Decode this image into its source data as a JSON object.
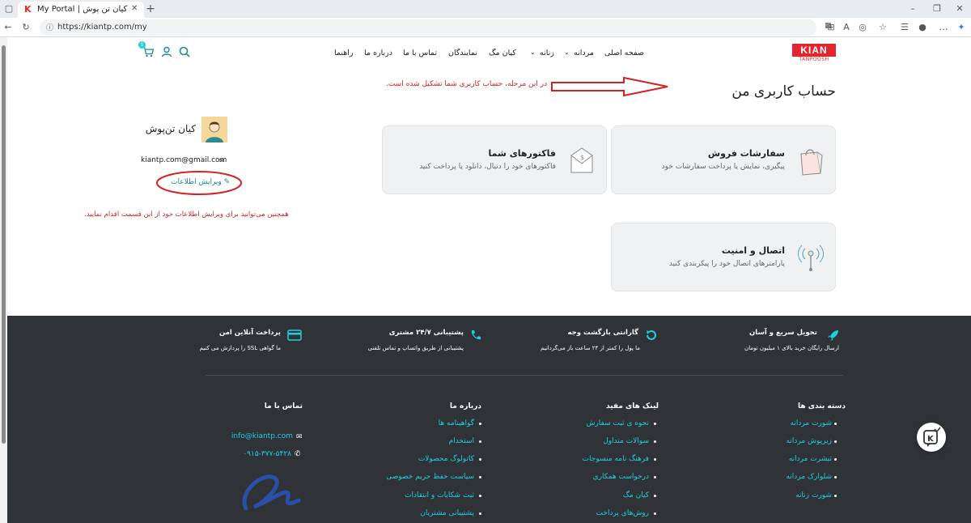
{
  "browser": {
    "tab_title": "My Portal | کیان تن پوش",
    "url": "https://kiantp.com/my"
  },
  "header": {
    "logo_text": "KIAN",
    "logo_sub": "TANPOOSH",
    "nav": [
      "صفحه اصلی",
      "مردانه",
      "زنانه",
      "کیان مگ",
      "نمایندگان",
      "تماس با ما",
      "درباره ما",
      "راهنما"
    ],
    "cart_count": "0"
  },
  "account": {
    "page_title": "حساب کاربری من",
    "annotation_top": "در این مرحله، حساب کاربری شما تشکیل شده است.",
    "annotation_side": "همچنین می‌توانید برای ویرایش اطلاعات خود از این قسمت اقدام نمایید.",
    "cards": [
      {
        "title": "سفارشات فروش",
        "desc": "پیگیری، نمایش یا پرداخت سفارشات خود"
      },
      {
        "title": "فاکتورهای شما",
        "desc": "فاکتورهای خود را دنبال، دانلود یا پرداخت کنید"
      },
      {
        "title": "اتصال و امنیت",
        "desc": "پارامترهای اتصال خود را پیکربندی کنید"
      }
    ],
    "profile": {
      "name": "کیان تن‌پوش",
      "email": "kiantp.com@gmail.com",
      "edit_label": "ویرایش اطلاعات"
    }
  },
  "footer": {
    "features": [
      {
        "title": "تحویل سریع و آسان",
        "desc": "ارسال رایگان خرید بالای ۱ میلیون تومان"
      },
      {
        "title": "گارانتی بازگشت وجه",
        "desc": "ما پول را کمتر از ۲۴ ساعت باز می‌گردانیم"
      },
      {
        "title": "پشتیبانی ۲۴/۷ مشتری",
        "desc": "پشتیبانی از طریق واتساپ و تماس تلفنی"
      },
      {
        "title": "پرداخت آنلاین امن",
        "desc": "ما گواهی SSL را پردازش می کنیم"
      }
    ],
    "columns": [
      {
        "title": "دسته بندی ها",
        "links": [
          "شورت مردانه",
          "زیرپوش مردانه",
          "تیشرت مردانه",
          "شلوارک مردانه",
          "شورت زنانه"
        ]
      },
      {
        "title": "لینک های مفید",
        "links": [
          "نحوه ی ثبت سفارش",
          "سوالات متداول",
          "فرهنگ نامه منسوجات",
          "درخواست همکاری",
          "کیان مگ",
          "روش‌های پرداخت"
        ]
      },
      {
        "title": "درباره ما",
        "links": [
          "گواهینامه ها",
          "استخدام",
          "کاتولوگ محصولات",
          "سیاست حفظ حریم خصوصی",
          "ثبت شکایات و انتقادات",
          "پشتیبانی مشتریان"
        ]
      }
    ],
    "contact": {
      "title": "تماس با ما",
      "email": "info@kiantp.com",
      "phone": "۰۹۱۵-۳۷۷-۵۴۲۸"
    }
  },
  "colors": {
    "accent": "#1ecfe0",
    "annotation": "#d32222",
    "footer_bg": "#2f3338",
    "brand": "#e3262d"
  }
}
